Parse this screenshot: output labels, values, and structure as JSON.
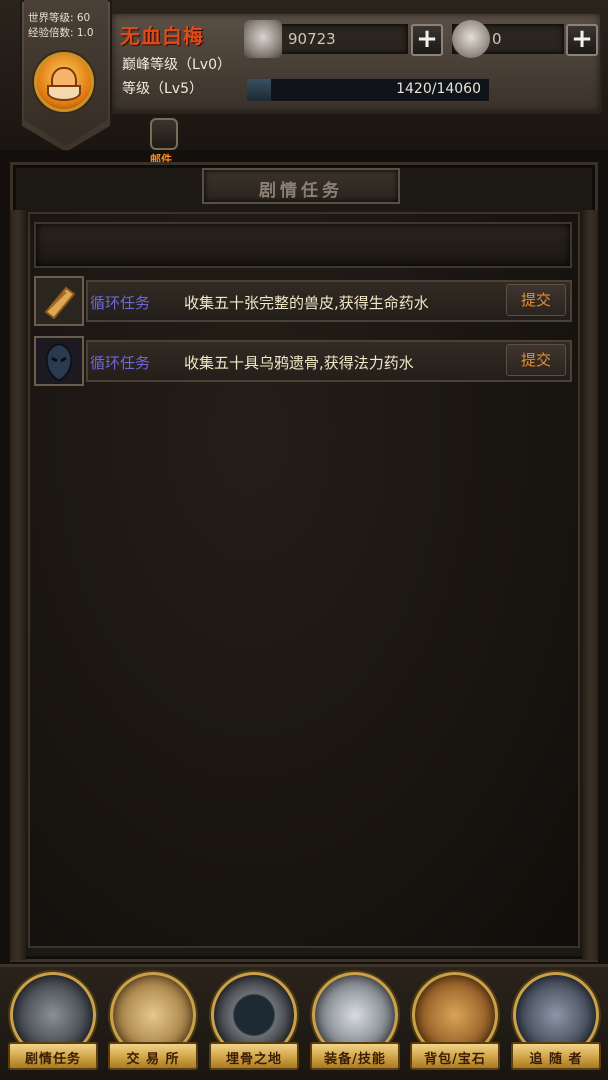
{
  "header": {
    "world_level": "世界等级: 60",
    "exp_rate": "经验倍数: 1.0",
    "player_name": "无血白梅",
    "peak_level": "巅峰等级（Lv0）",
    "level": "等级（Lv5）",
    "gold_value": "90723",
    "gem_value": "0",
    "plus_label": "+",
    "exp_text": "1420/14060",
    "exp_progress": 0.101,
    "mail_label": "邮件"
  },
  "panel": {
    "title": "剧情任务"
  },
  "quests": [
    {
      "icon": "scroll-icon",
      "type": "循环任务",
      "description": "收集五十张完整的兽皮,获得生命药水",
      "submit": "提交"
    },
    {
      "icon": "crow-icon",
      "type": "循环任务",
      "description": "收集五十具乌鸦遗骨,获得法力药水",
      "submit": "提交"
    }
  ],
  "nav": [
    {
      "label": "剧情任务",
      "icon": "knight-icon"
    },
    {
      "label": "交 易 所",
      "icon": "money-bag-icon"
    },
    {
      "label": "埋骨之地",
      "icon": "dungeon-gate-icon"
    },
    {
      "label": "装备/技能",
      "icon": "axe-icon"
    },
    {
      "label": "背包/宝石",
      "icon": "backpack-icon"
    },
    {
      "label": "追 随 者",
      "icon": "follower-icon"
    }
  ],
  "colors": {
    "player_name": "#e04a1a",
    "quest_type": "#6f66d9",
    "submit": "#f08a2a",
    "mail_label": "#ff8a1a"
  }
}
